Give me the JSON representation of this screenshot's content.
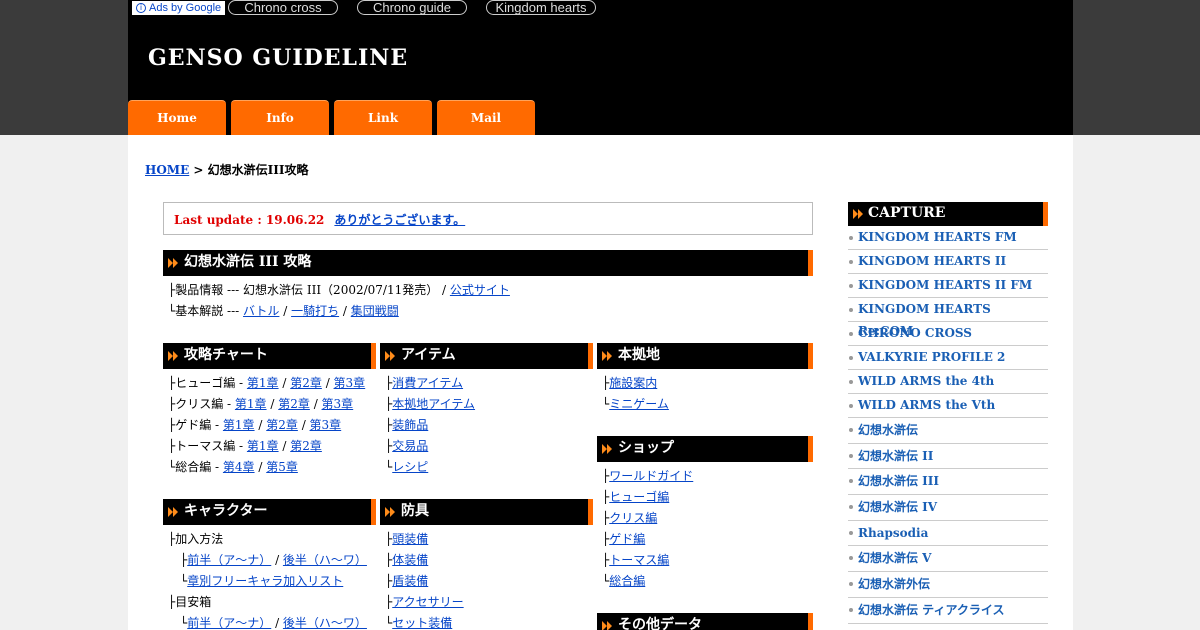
{
  "ads": {
    "badge": "Ads by Google",
    "links": [
      "Chrono cross",
      "Chrono guide",
      "Kingdom hearts"
    ]
  },
  "site_title": "GENSO GUIDELINE",
  "nav": [
    "Home",
    "Info",
    "Link",
    "Mail"
  ],
  "breadcrumb": {
    "home": "HOME",
    "sep": " > ",
    "current": "幻想水滸伝III攻略"
  },
  "notice": {
    "update": "Last update : 19.06.22",
    "thanks": "ありがとうございます。"
  },
  "main": {
    "title": "幻想水滸伝 III 攻略",
    "row1": {
      "prefix": "├製品情報 --- 幻想水滸伝 III（2002/07/11発売） / ",
      "link": "公式サイト"
    },
    "row2": {
      "prefix": "└基本解説 --- ",
      "links": [
        "バトル",
        "一騎打ち",
        "集団戦闘"
      ]
    }
  },
  "chart": {
    "title": "攻略チャート",
    "rows": [
      {
        "prefix": "├ヒューゴ編 - ",
        "links": [
          "第1章",
          "第2章",
          "第3章"
        ]
      },
      {
        "prefix": "├クリス編 - ",
        "links": [
          "第1章",
          "第2章",
          "第3章"
        ]
      },
      {
        "prefix": "├ゲド編 - ",
        "links": [
          "第1章",
          "第2章",
          "第3章"
        ]
      },
      {
        "prefix": "├トーマス編 - ",
        "links": [
          "第1章",
          "第2章"
        ]
      },
      {
        "prefix": "└総合編 - ",
        "links": [
          "第4章",
          "第5章"
        ]
      }
    ]
  },
  "items": {
    "title": "アイテム",
    "rows": [
      {
        "prefix": "├",
        "link": "消費アイテム"
      },
      {
        "prefix": "├",
        "link": "本拠地アイテム"
      },
      {
        "prefix": "├",
        "link": "装飾品"
      },
      {
        "prefix": "├",
        "link": "交易品"
      },
      {
        "prefix": "└",
        "link": "レシピ"
      }
    ]
  },
  "base": {
    "title": "本拠地",
    "rows": [
      {
        "prefix": "├",
        "link": "施設案内"
      },
      {
        "prefix": "└",
        "link": "ミニゲーム"
      }
    ]
  },
  "shop": {
    "title": "ショップ",
    "rows": [
      {
        "prefix": "├",
        "link": "ワールドガイド"
      },
      {
        "prefix": "├",
        "link": "ヒューゴ編"
      },
      {
        "prefix": "├",
        "link": "クリス編"
      },
      {
        "prefix": "├",
        "link": "ゲド編"
      },
      {
        "prefix": "├",
        "link": "トーマス編"
      },
      {
        "prefix": "└",
        "link": "総合編"
      }
    ]
  },
  "other": {
    "title": "その他データ"
  },
  "character": {
    "title": "キャラクター",
    "join": "├加入方法",
    "join_links": [
      "前半（ア～ナ）",
      "後半（ハ～ワ）"
    ],
    "free_list": "章別フリーキャラ加入リスト",
    "box": "├目安箱",
    "box_links": [
      "前半（ア～ナ）",
      "後半（ハ～ワ）"
    ],
    "sub_mid": "├",
    "sub_end": "└"
  },
  "armor": {
    "title": "防具",
    "rows": [
      {
        "prefix": "├",
        "link": "頭装備"
      },
      {
        "prefix": "├",
        "link": "体装備"
      },
      {
        "prefix": "├",
        "link": "盾装備"
      },
      {
        "prefix": "├",
        "link": "アクセサリー"
      },
      {
        "prefix": "└",
        "link": "セット装備"
      }
    ]
  },
  "sidebar": {
    "title": "CAPTURE",
    "items": [
      "KINGDOM HEARTS FM",
      "KINGDOM HEARTS II",
      "KINGDOM HEARTS II FM",
      "KINGDOM HEARTS Re:COM",
      "CHRONO CROSS",
      "VALKYRIE PROFILE 2",
      "WILD ARMS the 4th",
      "WILD ARMS the Vth",
      "幻想水滸伝",
      "幻想水滸伝 II",
      "幻想水滸伝 III",
      "幻想水滸伝 IV",
      "Rhapsodia",
      "幻想水滸伝 V",
      "幻想水滸外伝",
      "幻想水滸伝 ティアクライス"
    ]
  },
  "colors": {
    "accent": "#ff6a00",
    "header": "#000000",
    "link": "#0645c8",
    "update": "#e00000"
  }
}
